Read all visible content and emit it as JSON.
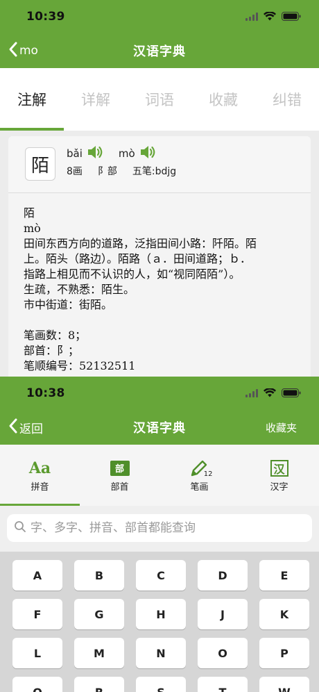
{
  "top_screen": {
    "status": {
      "time": "10:39"
    },
    "nav": {
      "back_label": "mo",
      "title": "汉语字典"
    },
    "tabs": [
      "注解",
      "详解",
      "词语",
      "收藏",
      "纠错"
    ],
    "entry": {
      "character": "陌",
      "pronunciations": [
        "bǎi",
        "mò"
      ],
      "strokes": "8画",
      "radical": "阝部",
      "wubi": "五笔:bdjg",
      "body_lines": [
        "陌",
        "mò",
        "田间东西方向的道路，泛指田间小路：阡陌。陌",
        "上。陌头（路边）。陌路（ａ．田间道路；ｂ．",
        "指路上相见而不认识的人，如“视同陌陌”）。",
        "生疏，不熟悉：陌生。",
        "市中街道：街陌。"
      ],
      "stats_lines": [
        "笔画数：8；",
        "部首：阝；",
        "笔顺编号：52132511"
      ]
    }
  },
  "bottom_screen": {
    "status": {
      "time": "10:38"
    },
    "nav": {
      "back_label": "返回",
      "title": "汉语字典",
      "right_label": "收藏夹"
    },
    "modes": [
      {
        "label": "拼音",
        "icon": "pinyin-icon",
        "glyph": "Aa"
      },
      {
        "label": "部首",
        "icon": "radical-icon",
        "glyph": "部"
      },
      {
        "label": "笔画",
        "icon": "pencil-icon",
        "glyph": "12"
      },
      {
        "label": "汉字",
        "icon": "hanzi-icon",
        "glyph": "汉"
      }
    ],
    "search": {
      "placeholder": "字、多字、拼音、部首都能查询"
    },
    "keyboard": [
      "A",
      "B",
      "C",
      "D",
      "E",
      "F",
      "G",
      "H",
      "J",
      "K",
      "L",
      "M",
      "N",
      "O",
      "P",
      "Q",
      "R",
      "S",
      "T",
      "W"
    ]
  },
  "colors": {
    "accent": "#67a639"
  }
}
